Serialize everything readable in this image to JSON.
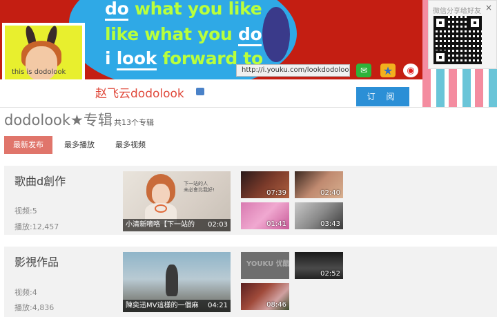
{
  "banner": {
    "slogan_lines": [
      {
        "pre": "",
        "under": "do",
        "post": " what you like"
      },
      {
        "pre": "like what you ",
        "under": "do",
        "post": ""
      },
      {
        "pre": "i ",
        "under": "look",
        "post": " forward to"
      }
    ],
    "avatar_tag": "this is dodolook",
    "url": "http://i.youku.com/lookdodolook",
    "share_icons": [
      "wechat-icon",
      "star-icon",
      "weibo-icon"
    ],
    "qr": {
      "title": "微信分享给好友",
      "close": "×"
    }
  },
  "profile": {
    "username": "赵飞云dodolook",
    "subscribe_label": "订 阅"
  },
  "album": {
    "title": "dodolook★专辑",
    "count": "共13个专辑"
  },
  "tabs": [
    {
      "label": "最新发布",
      "active": true
    },
    {
      "label": "最多播放",
      "active": false
    },
    {
      "label": "最多视频",
      "active": false
    }
  ],
  "sections": [
    {
      "title": "歌曲d創作",
      "videos": "视频:5",
      "plays": "播放:12,457",
      "feature": {
        "caption": "小清新嘀咯【下一站的",
        "duration": "02:03",
        "bubble": [
          "下一站的人",
          "未必會比我好!"
        ]
      },
      "thumbs": [
        "07:39",
        "02:40",
        "01:41",
        "03:43"
      ]
    },
    {
      "title": "影視作品",
      "videos": "视频:4",
      "plays": "播放:4,836",
      "feature": {
        "caption": "陳奕迅MV這樣的一個麻",
        "duration": "04:21"
      },
      "thumbs": [
        "",
        "02:52",
        "08:46"
      ],
      "thumb_logo": "YOUKU 优酷"
    }
  ],
  "colors": {
    "banner_red": "#c41e12",
    "banner_blue": "#2fa9e6",
    "slogan_green": "#b9ff3c",
    "username": "#e04a3c",
    "subscribe": "#2b8fd6",
    "tab_active": "#e0756b"
  }
}
